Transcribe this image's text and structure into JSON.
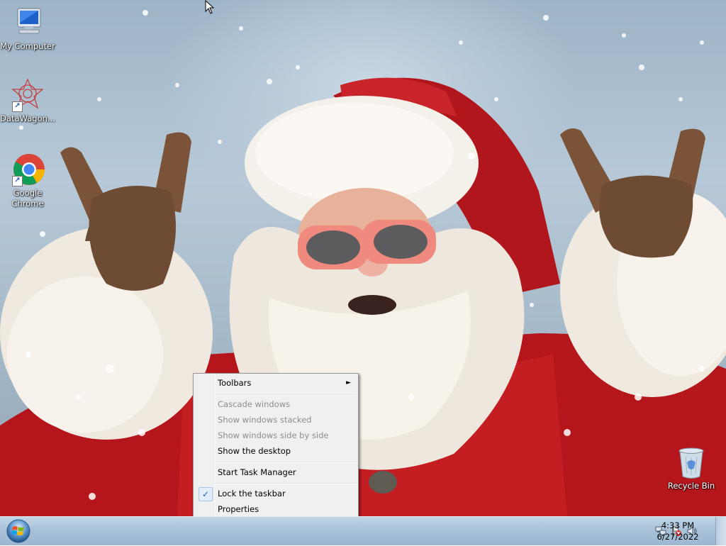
{
  "desktop": {
    "icons": [
      {
        "name": "My Computer",
        "icon": "computer-icon"
      },
      {
        "name": "DataWagon...",
        "icon": "datawagon-icon"
      },
      {
        "name": "Google\nChrome",
        "icon": "chrome-icon"
      },
      {
        "name": "Recycle Bin",
        "icon": "recycle-bin-icon"
      }
    ]
  },
  "context_menu": {
    "toolbars": "Toolbars",
    "cascade": "Cascade windows",
    "stacked": "Show windows stacked",
    "side_by_side": "Show windows side by side",
    "show_desktop": "Show the desktop",
    "task_manager": "Start Task Manager",
    "lock_taskbar": "Lock the taskbar",
    "properties": "Properties",
    "lock_checked": true,
    "check_glyph": "✓",
    "submenu_arrow": "►"
  },
  "taskbar": {
    "time": "4:33 PM",
    "date": "6/27/2022",
    "start_icon": "windows-orb-icon",
    "tray_icons": [
      "network-icon",
      "action-center-flag-icon",
      "volume-icon"
    ]
  }
}
